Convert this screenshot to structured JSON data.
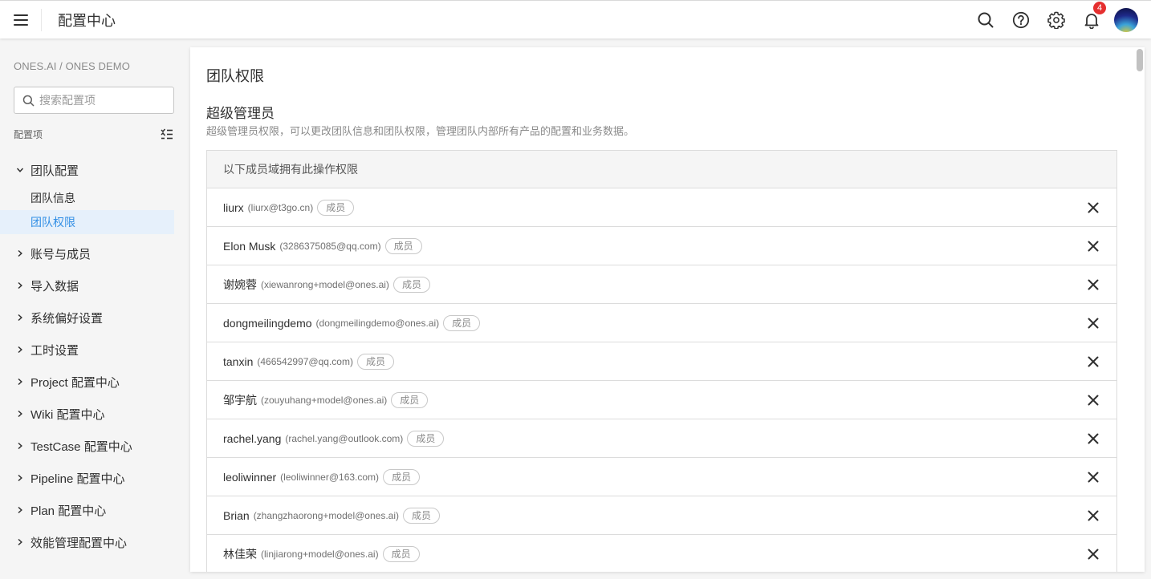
{
  "header": {
    "title": "配置中心",
    "notification_count": "4"
  },
  "sidebar": {
    "breadcrumb": "ONES.AI / ONES DEMO",
    "search_placeholder": "搜索配置项",
    "section_label": "配置项",
    "groups": [
      {
        "label": "团队配置",
        "expanded": true,
        "children": [
          {
            "label": "团队信息",
            "active": false
          },
          {
            "label": "团队权限",
            "active": true
          }
        ]
      },
      {
        "label": "账号与成员"
      },
      {
        "label": "导入数据"
      },
      {
        "label": "系统偏好设置"
      },
      {
        "label": "工时设置"
      },
      {
        "label": "Project 配置中心"
      },
      {
        "label": "Wiki 配置中心"
      },
      {
        "label": "TestCase 配置中心"
      },
      {
        "label": "Pipeline 配置中心"
      },
      {
        "label": "Plan 配置中心"
      },
      {
        "label": "效能管理配置中心"
      }
    ]
  },
  "main": {
    "page_title": "团队权限",
    "section_title": "超级管理员",
    "section_desc": "超级管理员权限，可以更改团队信息和团队权限，管理团队内部所有产品的配置和业务数据。",
    "table_header": "以下成员域拥有此操作权限",
    "members": [
      {
        "name": "liurx",
        "email": "(liurx@t3go.cn)",
        "tag": "成员"
      },
      {
        "name": "Elon Musk",
        "email": "(3286375085@qq.com)",
        "tag": "成员"
      },
      {
        "name": "谢婉蓉",
        "email": "(xiewanrong+model@ones.ai)",
        "tag": "成员"
      },
      {
        "name": "dongmeilingdemo",
        "email": "(dongmeilingdemo@ones.ai)",
        "tag": "成员"
      },
      {
        "name": "tanxin",
        "email": "(466542997@qq.com)",
        "tag": "成员"
      },
      {
        "name": "邹宇航",
        "email": "(zouyuhang+model@ones.ai)",
        "tag": "成员"
      },
      {
        "name": "rachel.yang",
        "email": "(rachel.yang@outlook.com)",
        "tag": "成员"
      },
      {
        "name": "leoliwinner",
        "email": "(leoliwinner@163.com)",
        "tag": "成员"
      },
      {
        "name": "Brian",
        "email": "(zhangzhaorong+model@ones.ai)",
        "tag": "成员"
      },
      {
        "name": "林佳荣",
        "email": "(linjiarong+model@ones.ai)",
        "tag": "成员"
      }
    ]
  },
  "colors": {
    "accent": "#338fe5",
    "active_bg": "#e6f0fb",
    "badge": "#e52f2f"
  }
}
